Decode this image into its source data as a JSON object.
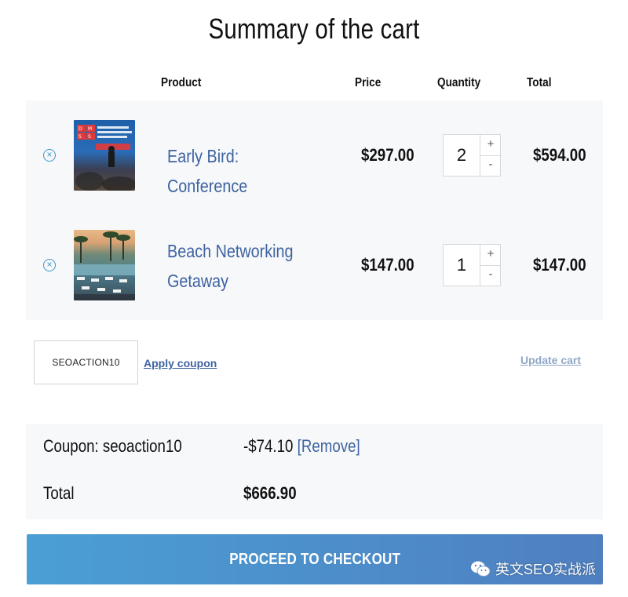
{
  "page": {
    "title": "Summary of the cart"
  },
  "table_headers": {
    "product": "Product",
    "price": "Price",
    "quantity": "Quantity",
    "total": "Total"
  },
  "cart_items": [
    {
      "name_line1": "Early Bird: Conference",
      "name_line2": "",
      "price": "$297.00",
      "quantity": "2",
      "total": "$594.00",
      "thumbnail_text": "D M S S DIGITAL MARKETING SKILL SHARE"
    },
    {
      "name_line1": "Beach Networking",
      "name_line2": "Getaway",
      "price": "$147.00",
      "quantity": "1",
      "total": "$147.00",
      "thumbnail_text": ""
    }
  ],
  "coupon": {
    "input_value": "SEOACTION10",
    "apply_label": "Apply coupon",
    "update_label": "Update cart"
  },
  "summary": {
    "coupon_label": "Coupon: seoaction10",
    "coupon_value": "-$74.10",
    "remove_label": "[Remove]",
    "total_label": "Total",
    "total_value": "$666.90"
  },
  "checkout": {
    "label": "PROCEED TO CHECKOUT"
  },
  "watermark": {
    "text": "英文SEO实战派"
  },
  "colors": {
    "link": "#3e63a0",
    "remove_icon": "#3f97c9",
    "checkout_start": "#4a9fd4",
    "checkout_end": "#4f7fc0",
    "panel_bg": "#f7f8fa"
  }
}
